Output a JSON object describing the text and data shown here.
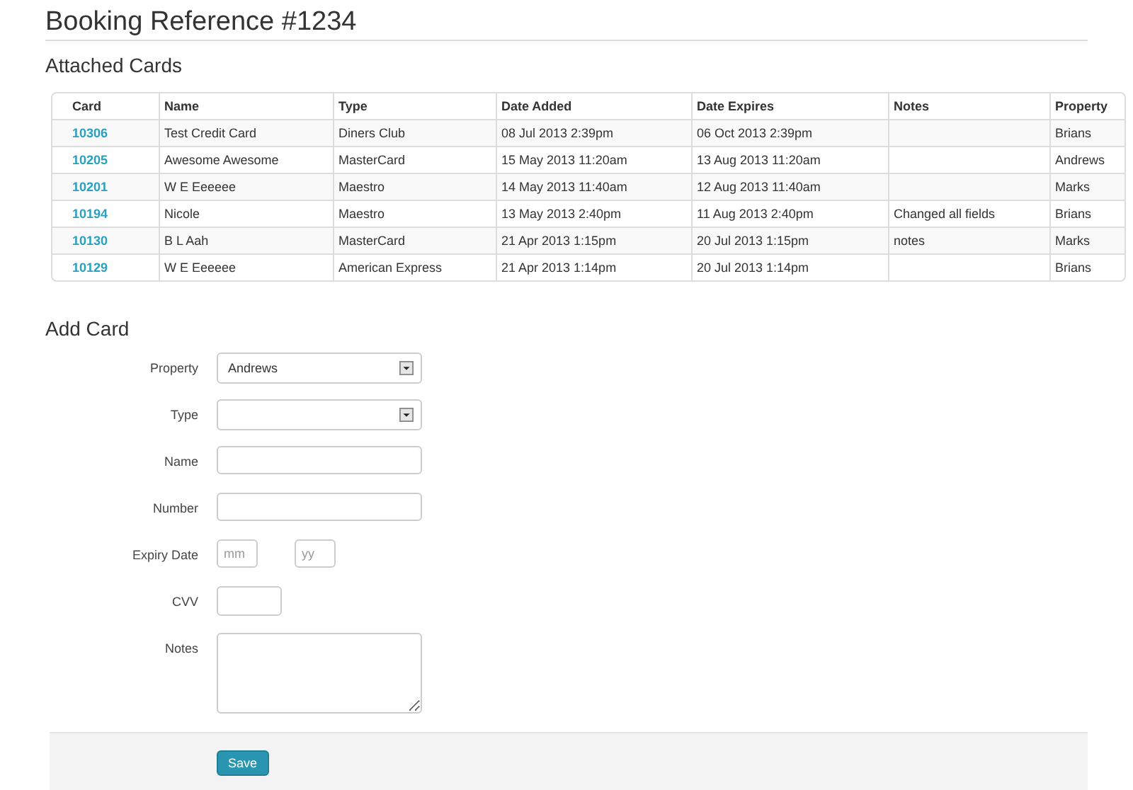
{
  "title": "Booking Reference #1234",
  "attached": {
    "heading": "Attached Cards",
    "columns": [
      "Card",
      "Name",
      "Type",
      "Date Added",
      "Date Expires",
      "Notes",
      "Property"
    ],
    "rows": [
      {
        "card": "10306",
        "name": "Test Credit Card",
        "type": "Diners Club",
        "added": "08 Jul 2013 2:39pm",
        "expires": "06 Oct 2013 2:39pm",
        "notes": "",
        "property": "Brians"
      },
      {
        "card": "10205",
        "name": "Awesome Awesome",
        "type": "MasterCard",
        "added": "15 May 2013 11:20am",
        "expires": "13 Aug 2013 11:20am",
        "notes": "",
        "property": "Andrews"
      },
      {
        "card": "10201",
        "name": "W E Eeeeee",
        "type": "Maestro",
        "added": "14 May 2013 11:40am",
        "expires": "12 Aug 2013 11:40am",
        "notes": "",
        "property": "Marks"
      },
      {
        "card": "10194",
        "name": "Nicole",
        "type": "Maestro",
        "added": "13 May 2013 2:40pm",
        "expires": "11 Aug 2013 2:40pm",
        "notes": "Changed all fields",
        "property": "Brians"
      },
      {
        "card": "10130",
        "name": "B L Aah",
        "type": "MasterCard",
        "added": "21 Apr 2013 1:15pm",
        "expires": "20 Jul 2013 1:15pm",
        "notes": "notes",
        "property": "Marks"
      },
      {
        "card": "10129",
        "name": "W E Eeeeee",
        "type": "American Express",
        "added": "21 Apr 2013 1:14pm",
        "expires": "20 Jul 2013 1:14pm",
        "notes": "",
        "property": "Brians"
      }
    ]
  },
  "add_card": {
    "heading": "Add Card",
    "fields": [
      {
        "label": "Property",
        "kind": "select",
        "value": "Andrews"
      },
      {
        "label": "Type",
        "kind": "select"
      },
      {
        "label": "Name",
        "kind": "text"
      },
      {
        "label": "Number",
        "kind": "text"
      },
      {
        "label": "Expiry Date",
        "kind": "expiry",
        "placeholders": [
          "mm",
          "yy"
        ]
      },
      {
        "label": "CVV",
        "kind": "short"
      },
      {
        "label": "Notes",
        "kind": "textarea"
      }
    ],
    "save_button": "Save"
  }
}
